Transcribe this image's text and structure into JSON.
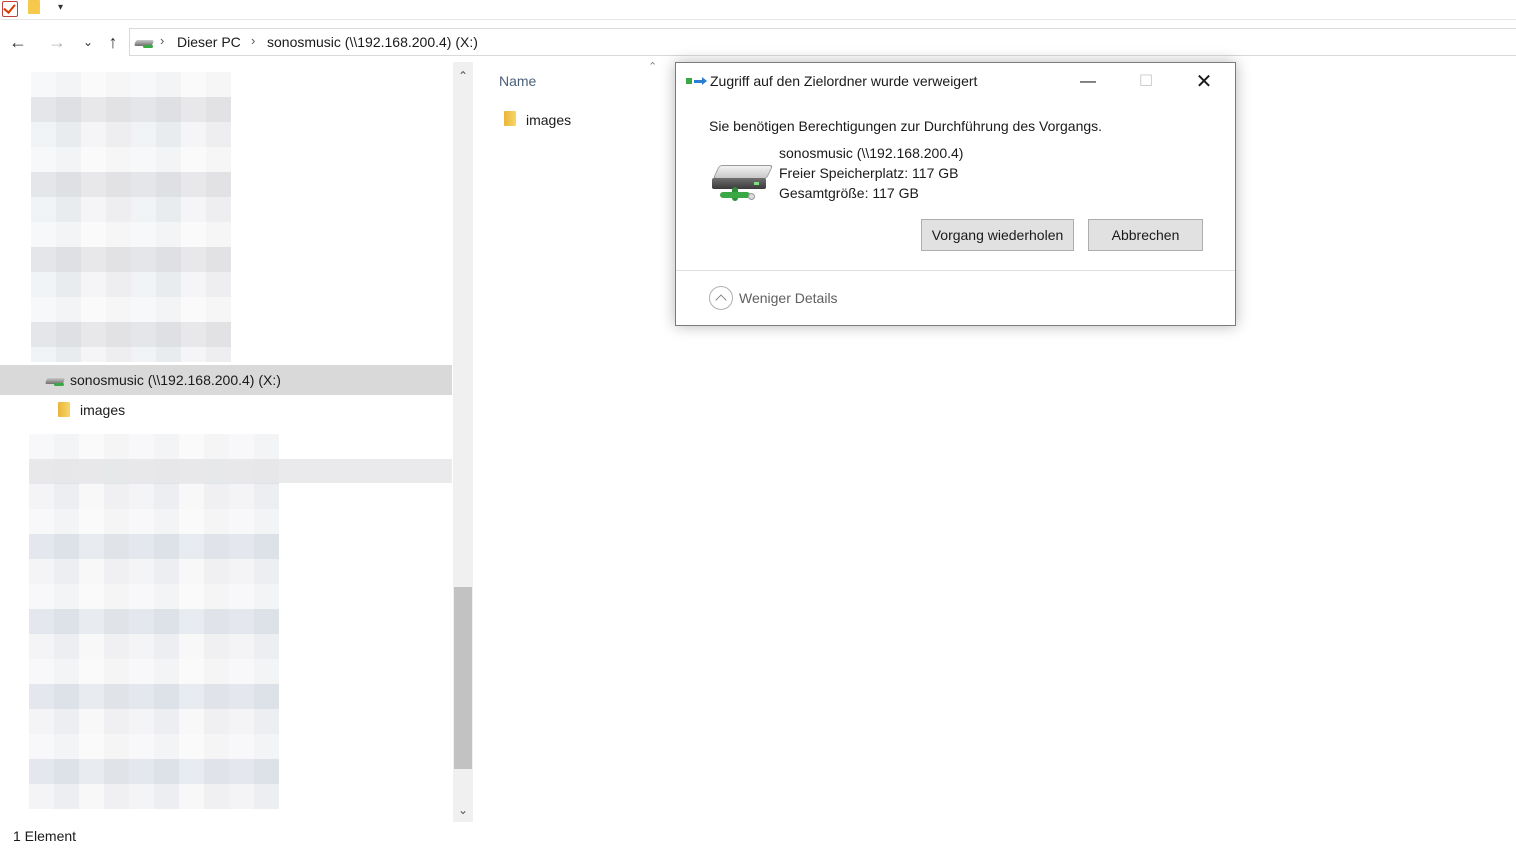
{
  "toolbar": {
    "dropdown_icon": "chevron-down-icon"
  },
  "navigation": {
    "back_icon": "arrow-left-icon",
    "forward_icon": "arrow-right-icon",
    "recent_icon": "chevron-down-icon",
    "up_icon": "arrow-up-icon",
    "breadcrumb": [
      "Dieser PC",
      "sonosmusic (\\\\192.168.200.4) (X:)"
    ]
  },
  "nav_pane": {
    "items": [
      {
        "label": "sonosmusic (\\\\192.168.200.4) (X:)",
        "icon": "network-drive-icon",
        "selected": true
      },
      {
        "label": "images",
        "icon": "folder-icon",
        "selected": false
      }
    ]
  },
  "content": {
    "column_header": "Name",
    "files": [
      {
        "label": "images",
        "icon": "folder-icon"
      }
    ]
  },
  "status": {
    "item_count": "1 Element"
  },
  "dialog": {
    "title": "Zugriff auf den Zielordner wurde verweigert",
    "message": "Sie benötigen Berechtigungen zur Durchführung des Vorgangs.",
    "drive_name": "sonosmusic (\\\\192.168.200.4)",
    "free_space": "Freier Speicherplatz: 117 GB",
    "total_size": "Gesamtgröße: 117 GB",
    "retry_label": "Vorgang wiederholen",
    "cancel_label": "Abbrechen",
    "details_label": "Weniger Details"
  },
  "colors": {
    "selection": "#d9d9d9",
    "button_bg": "#e1e1e1",
    "folder": "#f6c84c",
    "accent_blue": "#2a7fd4",
    "accent_green": "#3aa845"
  }
}
